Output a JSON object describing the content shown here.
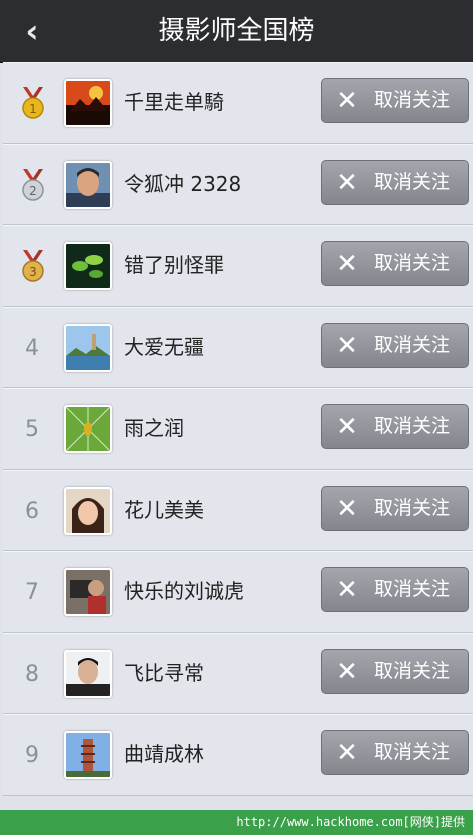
{
  "header": {
    "title": "摄影师全国榜",
    "back_icon": "chevron-left-icon"
  },
  "list": {
    "button_label": "取消关注",
    "button_icon": "close-icon",
    "items": [
      {
        "rank": "1",
        "medal": "gold",
        "name": "千里走单騎"
      },
      {
        "rank": "2",
        "medal": "silver",
        "name": "令狐冲 2328"
      },
      {
        "rank": "3",
        "medal": "bronze",
        "name": "错了别怪罪"
      },
      {
        "rank": "4",
        "name": "大爱无疆"
      },
      {
        "rank": "5",
        "name": "雨之润"
      },
      {
        "rank": "6",
        "name": "花儿美美"
      },
      {
        "rank": "7",
        "name": "快乐的刘诚虎"
      },
      {
        "rank": "8",
        "name": "飞比寻常"
      },
      {
        "rank": "9",
        "name": "曲靖成林"
      }
    ]
  },
  "footer": {
    "watermark": "http://www.hackhome.com[网侠]提供"
  },
  "colors": {
    "header_bg": "#2b2d31",
    "row_bg": "#e2e5ec",
    "button_bg": "#94979e",
    "footer_bg": "#3aa04a"
  }
}
